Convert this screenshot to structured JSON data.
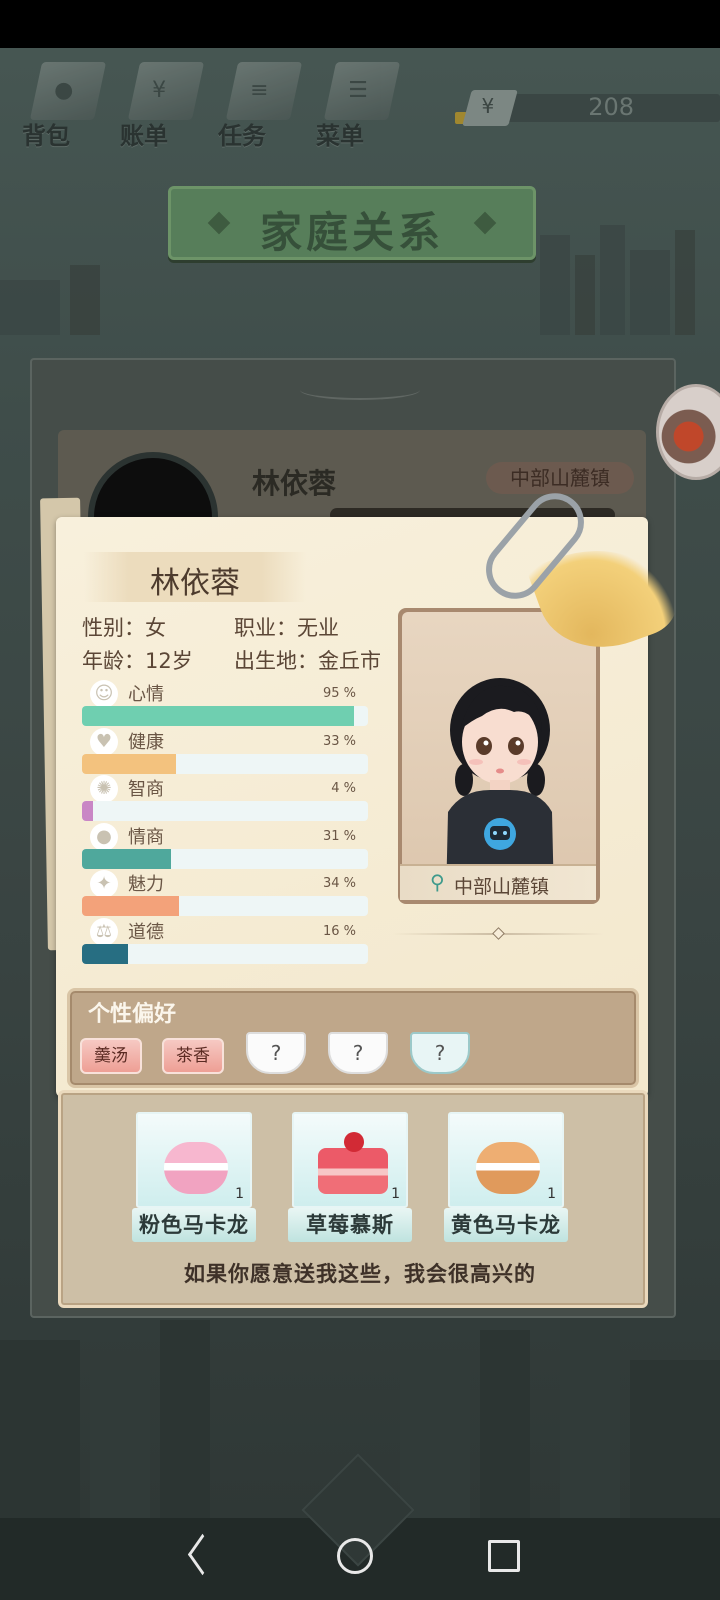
{
  "top_menu": {
    "items": [
      {
        "label": "背包",
        "icon": "bag-icon"
      },
      {
        "label": "账单",
        "icon": "bill-icon"
      },
      {
        "label": "任务",
        "icon": "task-icon"
      },
      {
        "label": "菜单",
        "icon": "menu-icon"
      }
    ],
    "money": {
      "symbol": "¥",
      "value": "208"
    }
  },
  "title": "家庭关系",
  "behind_card": {
    "name": "林依蓉",
    "location": "中部山麓镇"
  },
  "profile": {
    "name": "林依蓉",
    "gender": "性别：女",
    "job": "职业：无业",
    "age": "年龄：12岁",
    "birthplace": "出生地：金丘市",
    "location": "中部山麓镇"
  },
  "stats": [
    {
      "label": "心情",
      "pct_text": "95 %",
      "value": 95,
      "color": "#6fcfb0",
      "icon": "smile-icon"
    },
    {
      "label": "健康",
      "pct_text": "33 %",
      "value": 33,
      "color": "#f3c27e",
      "icon": "heart-icon"
    },
    {
      "label": "智商",
      "pct_text": "4 %",
      "value": 4,
      "color": "#c986c5",
      "icon": "lightbulb-icon"
    },
    {
      "label": "情商",
      "pct_text": "31 %",
      "value": 31,
      "color": "#4fa89c",
      "icon": "apple-icon"
    },
    {
      "label": "魅力",
      "pct_text": "34 %",
      "value": 34,
      "color": "#f3a27a",
      "icon": "sparkle-icon"
    },
    {
      "label": "道德",
      "pct_text": "16 %",
      "value": 16,
      "color": "#276e82",
      "icon": "scale-icon"
    }
  ],
  "preferences": {
    "title": "个性偏好",
    "tags": [
      "羹汤",
      "茶香"
    ],
    "unknown": [
      "?",
      "?",
      "?"
    ]
  },
  "gifts": {
    "items": [
      {
        "label": "粉色马卡龙",
        "count": "1"
      },
      {
        "label": "草莓慕斯",
        "count": "1"
      },
      {
        "label": "黄色马卡龙",
        "count": "1"
      }
    ],
    "hint": "如果你愿意送我这些，我会很高兴的"
  }
}
